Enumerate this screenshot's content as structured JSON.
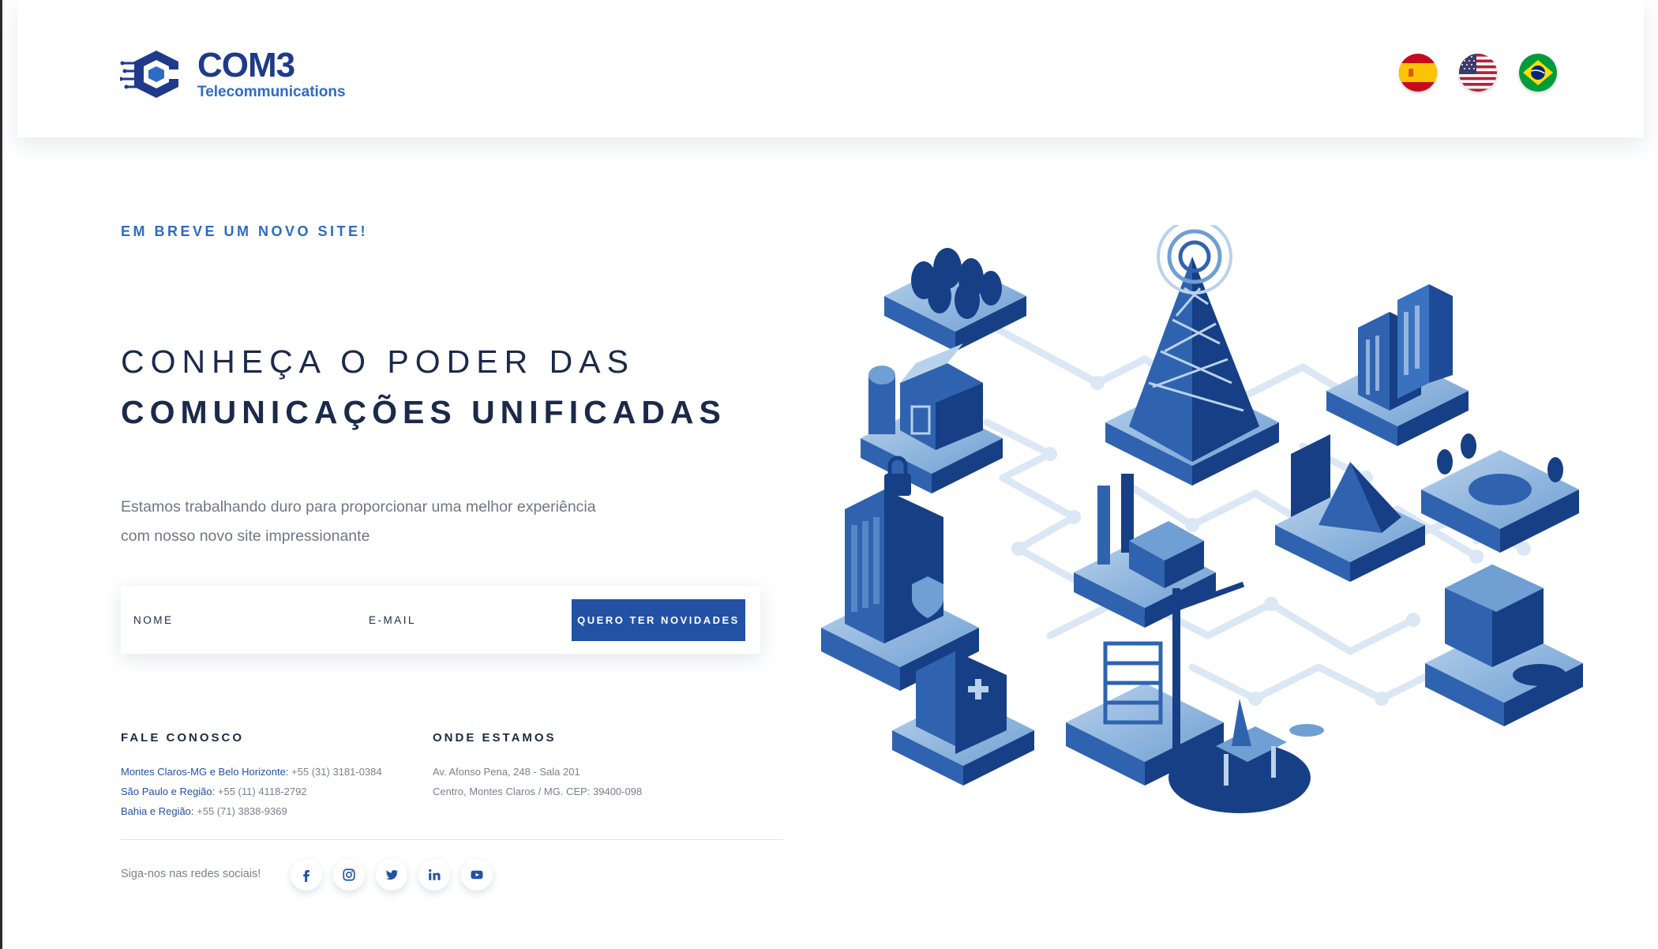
{
  "header": {
    "logo": {
      "name": "COM3",
      "subtitle": "Telecommunications"
    },
    "languages": [
      {
        "label": "Español",
        "icon": "spain-flag-icon"
      },
      {
        "label": "English",
        "icon": "usa-flag-icon"
      },
      {
        "label": "Português",
        "icon": "brazil-flag-icon"
      }
    ]
  },
  "hero": {
    "eyebrow": "EM BREVE UM NOVO SITE!",
    "title_line1": "CONHEÇA O PODER DAS",
    "title_line2": "COMUNICAÇÕES UNIFICADAS",
    "description_line1": "Estamos trabalhando duro para proporcionar uma melhor experiência",
    "description_line2": "com nosso novo site impressionante"
  },
  "form": {
    "name_placeholder": "NOME",
    "email_placeholder": "E-MAIL",
    "name_value": "",
    "email_value": "",
    "submit_label": "QUERO TER NOVIDADES"
  },
  "contact": {
    "title": "FALE CONOSCO",
    "items": [
      {
        "region": "Montes Claros-MG e Belo Horizonte:",
        "phone": "+55 (31) 3181-0384"
      },
      {
        "region": "São Paulo e Região:",
        "phone": "+55 (11) 4118-2792"
      },
      {
        "region": "Bahia e Região:",
        "phone": "+55 (71) 3838-9369"
      }
    ]
  },
  "location": {
    "title": "ONDE ESTAMOS",
    "line1": "Av. Afonso Pena, 248 - Sala 201",
    "line2": "Centro, Montes Claros / MG. CEP: 39400-098"
  },
  "social": {
    "label": "Siga-nos nas redes sociais!",
    "icons": [
      "facebook-icon",
      "instagram-icon",
      "twitter-icon",
      "linkedin-icon",
      "youtube-icon"
    ]
  },
  "colors": {
    "primary": "#2351a3",
    "accent": "#2b6cc4",
    "heading": "#1b2a4a",
    "muted": "#707784"
  }
}
